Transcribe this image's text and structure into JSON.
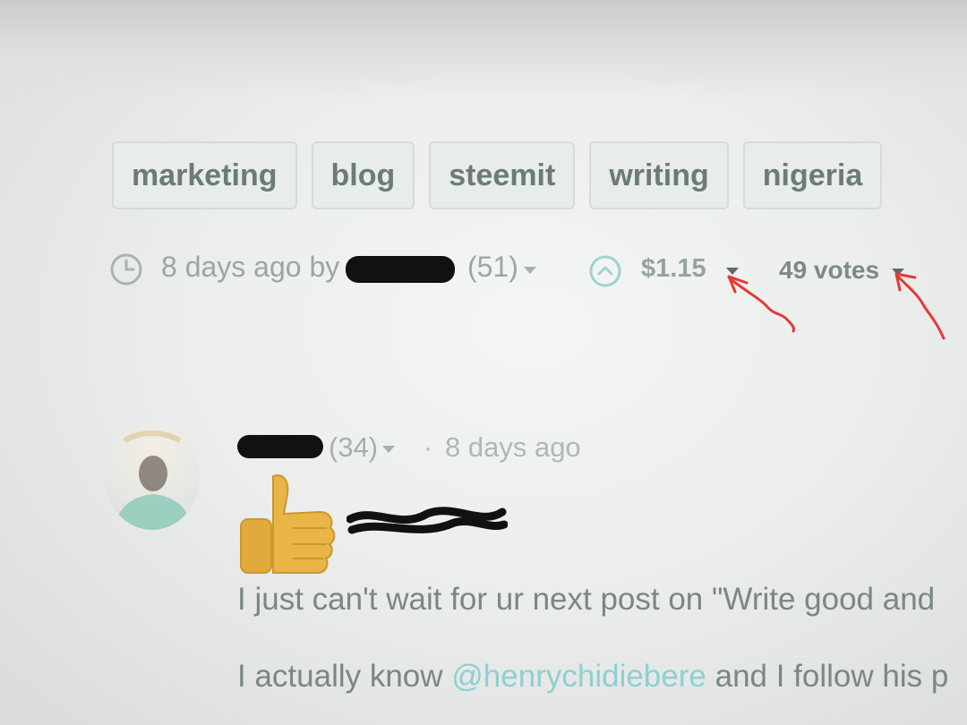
{
  "tags": [
    "marketing",
    "blog",
    "steemit",
    "writing",
    "nigeria"
  ],
  "post_meta": {
    "age_text": "8 days ago by",
    "author_reputation": "(51)",
    "payout": "$1.15",
    "votes": "49 votes"
  },
  "comment": {
    "author_reputation": "(34)",
    "separator": "·",
    "age": "8 days ago",
    "line1": "I just can't wait for ur next post on \"Write good and",
    "line2_prefix": "I actually know ",
    "mention": "@henrychidiebere",
    "line2_suffix": " and I follow his p"
  },
  "colors": {
    "tag_text": "#6b7b79",
    "meta_text": "#9aa6a4",
    "mention": "#8fcfd1",
    "annotation": "#e53935"
  },
  "icons": {
    "clock": "clock-icon",
    "upvote": "upvote-circle-icon",
    "thumb": "thumbs-up-emoji"
  }
}
